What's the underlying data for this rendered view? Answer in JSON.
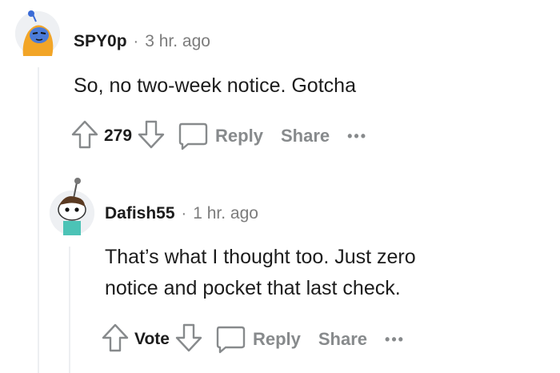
{
  "comments": [
    {
      "username": "SPY0p",
      "time": "3 hr. ago",
      "body": [
        "So, no two-week notice. Gotcha"
      ],
      "score": "279",
      "reply_label": "Reply",
      "share_label": "Share",
      "more_label": "•••"
    },
    {
      "username": "Dafish55",
      "time": "1 hr. ago",
      "body": [
        "That’s what I thought too. Just zero",
        "notice and pocket that last check."
      ],
      "score": "Vote",
      "reply_label": "Reply",
      "share_label": "Share",
      "more_label": "•••"
    }
  ],
  "separator": "·",
  "colors": {
    "meta_grey": "#7c7c7c",
    "action_grey": "#878a8c",
    "thread_line": "#edeff1",
    "avatar_bg": "#eef0f3"
  },
  "icons": [
    "snoo-avatar-icon",
    "upvote-icon",
    "downvote-icon",
    "comment-bubble-icon"
  ]
}
